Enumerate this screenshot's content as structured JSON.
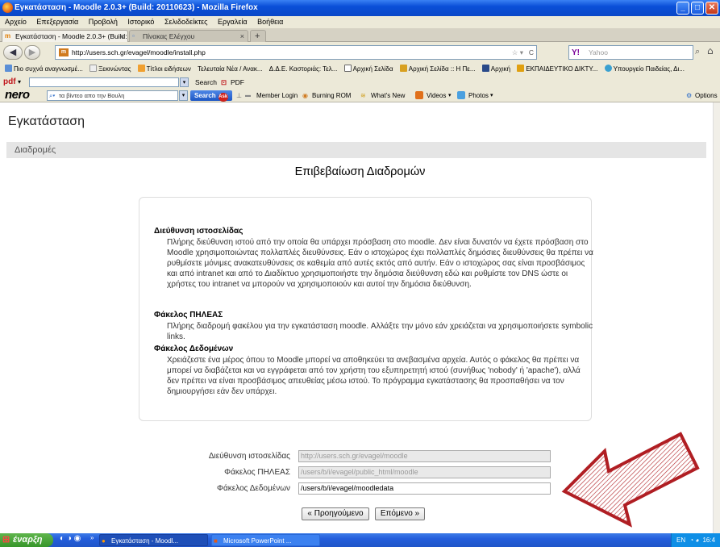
{
  "window": {
    "title": "Εγκατάσταση - Moodle 2.0.3+ (Build: 20110623) - Mozilla Firefox"
  },
  "menu": [
    "Αρχείο",
    "Επεξεργασία",
    "Προβολή",
    "Ιστορικό",
    "Σελιδοδείκτες",
    "Εργαλεία",
    "Βοήθεια"
  ],
  "tabs": [
    {
      "label": "Εγκατάσταση - Moodle 2.0.3+ (Build: 20..."
    },
    {
      "label": "Πίνακας Ελέγχου"
    }
  ],
  "nav": {
    "url": "http://users.sch.gr/evagel/moodle/install.php",
    "search_placeholder": "Yahoo"
  },
  "bookmarks": [
    "Πιο συχνά αναγνωσμέ...",
    "Ξεκινώντας",
    "Τίτλοι ειδήσεων",
    "Τελευταία Νέα / Ανακ...",
    "Δ.Δ.Ε. Καστοριάς: Τελ...",
    "Αρχική Σελίδα",
    "Αρχική Σελίδα :: Η Πε...",
    "Αρχική",
    "ΕΚΠΑΙΔΕΥΤΙΚΟ ΔΙΚΤΥ...",
    "Υπουργείο Παιδείας, Δι..."
  ],
  "pdfbar": {
    "label": "pdf",
    "search": "Search",
    "pdf": "PDF"
  },
  "nerobar": {
    "brand": "nero",
    "query": "τα βίντεο απο την Βουλη",
    "search": "Search",
    "items": [
      "Member Login",
      "Burning ROM",
      "What's New",
      "Videos",
      "Photos"
    ],
    "options": "Options"
  },
  "page": {
    "header": "Εγκατάσταση",
    "breadcrumb": "Διαδρομές",
    "title": "Επιβεβαίωση Διαδρομών",
    "sections": [
      {
        "term": "Διεύθυνση ιστοσελίδας",
        "desc": "Πλήρης διεύθυνση ιστού από την οποία θα υπάρχει πρόσβαση στο moodle. Δεν είναι δυνατόν να έχετε πρόσβαση στο Moodle χρησιμοποιώντας πολλαπλές διευθύνσεις. Εάν ο ιστοχώρος έχει πολλαπλές δημόσιες διευθύνσεις θα πρέπει να ρυθμίσετε μόνιμες ανακατευθύνσεις σε καθεμία από αυτές εκτός από αυτήν. Εάν ο ιστοχώρος σας είναι προσβάσιμος και από intranet και από το Διαδίκτυο χρησιμοποιήστε την δημόσια διεύθυνση εδώ και ρυθμίστε τον DNS ώστε οι χρήστες του intranet να μπορούν να χρησιμοποιούν και αυτοί την δημόσια διεύθυνση."
      },
      {
        "term": "Φάκελος ΠΗΛΕΑΣ",
        "desc": "Πλήρης διαδρομή φακέλου για την εγκατάσταση moodle. Αλλάξτε την μόνο εάν χρειάζεται να χρησιμοποιήσετε symbolic links."
      },
      {
        "term": "Φάκελος Δεδομένων",
        "desc": "Χρειάζεστε ένα μέρος όπου το Moodle μπορεί να αποθηκεύει τα ανεβασμένα αρχεία. Αυτός ο φάκελος θα πρέπει να μπορεί να διαβάζεται και να εγγράφεται από τον χρήστη του εξυπηρετητή ιστού (συνήθως 'nobody' ή 'apache'), αλλά δεν πρέπει να είναι προσβάσιμος απευθείας μέσω ιστού. Το πρόγραμμα εγκατάστασης θα προσπαθήσει να τον δημιουργήσει εάν δεν υπάρχει."
      }
    ],
    "fields": [
      {
        "label": "Διεύθυνση ιστοσελίδας",
        "value": "http://users.sch.gr/evagel/moodle"
      },
      {
        "label": "Φάκελος ΠΗΛΕΑΣ",
        "value": "/users/b/i/evagel/public_html/moodle"
      },
      {
        "label": "Φάκελος Δεδομένων",
        "value": "/users/b/i/evagel/moodledata"
      }
    ],
    "buttons": {
      "prev": "« Προηγούμενο",
      "next": "Επόμενο »"
    }
  },
  "taskbar": {
    "start": "έναρξη",
    "tasks": [
      "Εγκατάσταση - Moodl...",
      "Microsoft PowerPoint ..."
    ],
    "tray": {
      "lang": "EN",
      "time": "16:4"
    }
  },
  "colors": {
    "arrow": "#b01e23",
    "titlebar": "#0a4fd8",
    "taskbar": "#245edb"
  }
}
